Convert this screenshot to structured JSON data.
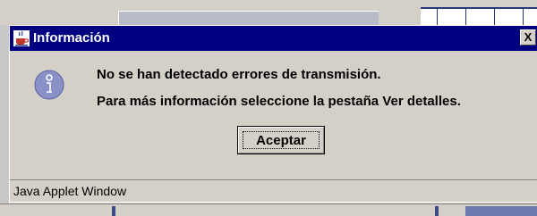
{
  "dialog": {
    "title": "Información",
    "close_label": "X",
    "icon": "info-icon",
    "message_line1": "No se han detectado errores de transmisión.",
    "message_line2": "Para más información seleccione la pestaña Ver detalles.",
    "ok_label": "Aceptar",
    "status_text": "Java Applet Window"
  },
  "colors": {
    "titlebar": "#000080",
    "dialog_bg": "#d4d0c8",
    "icon_fill": "#8a90c8"
  }
}
